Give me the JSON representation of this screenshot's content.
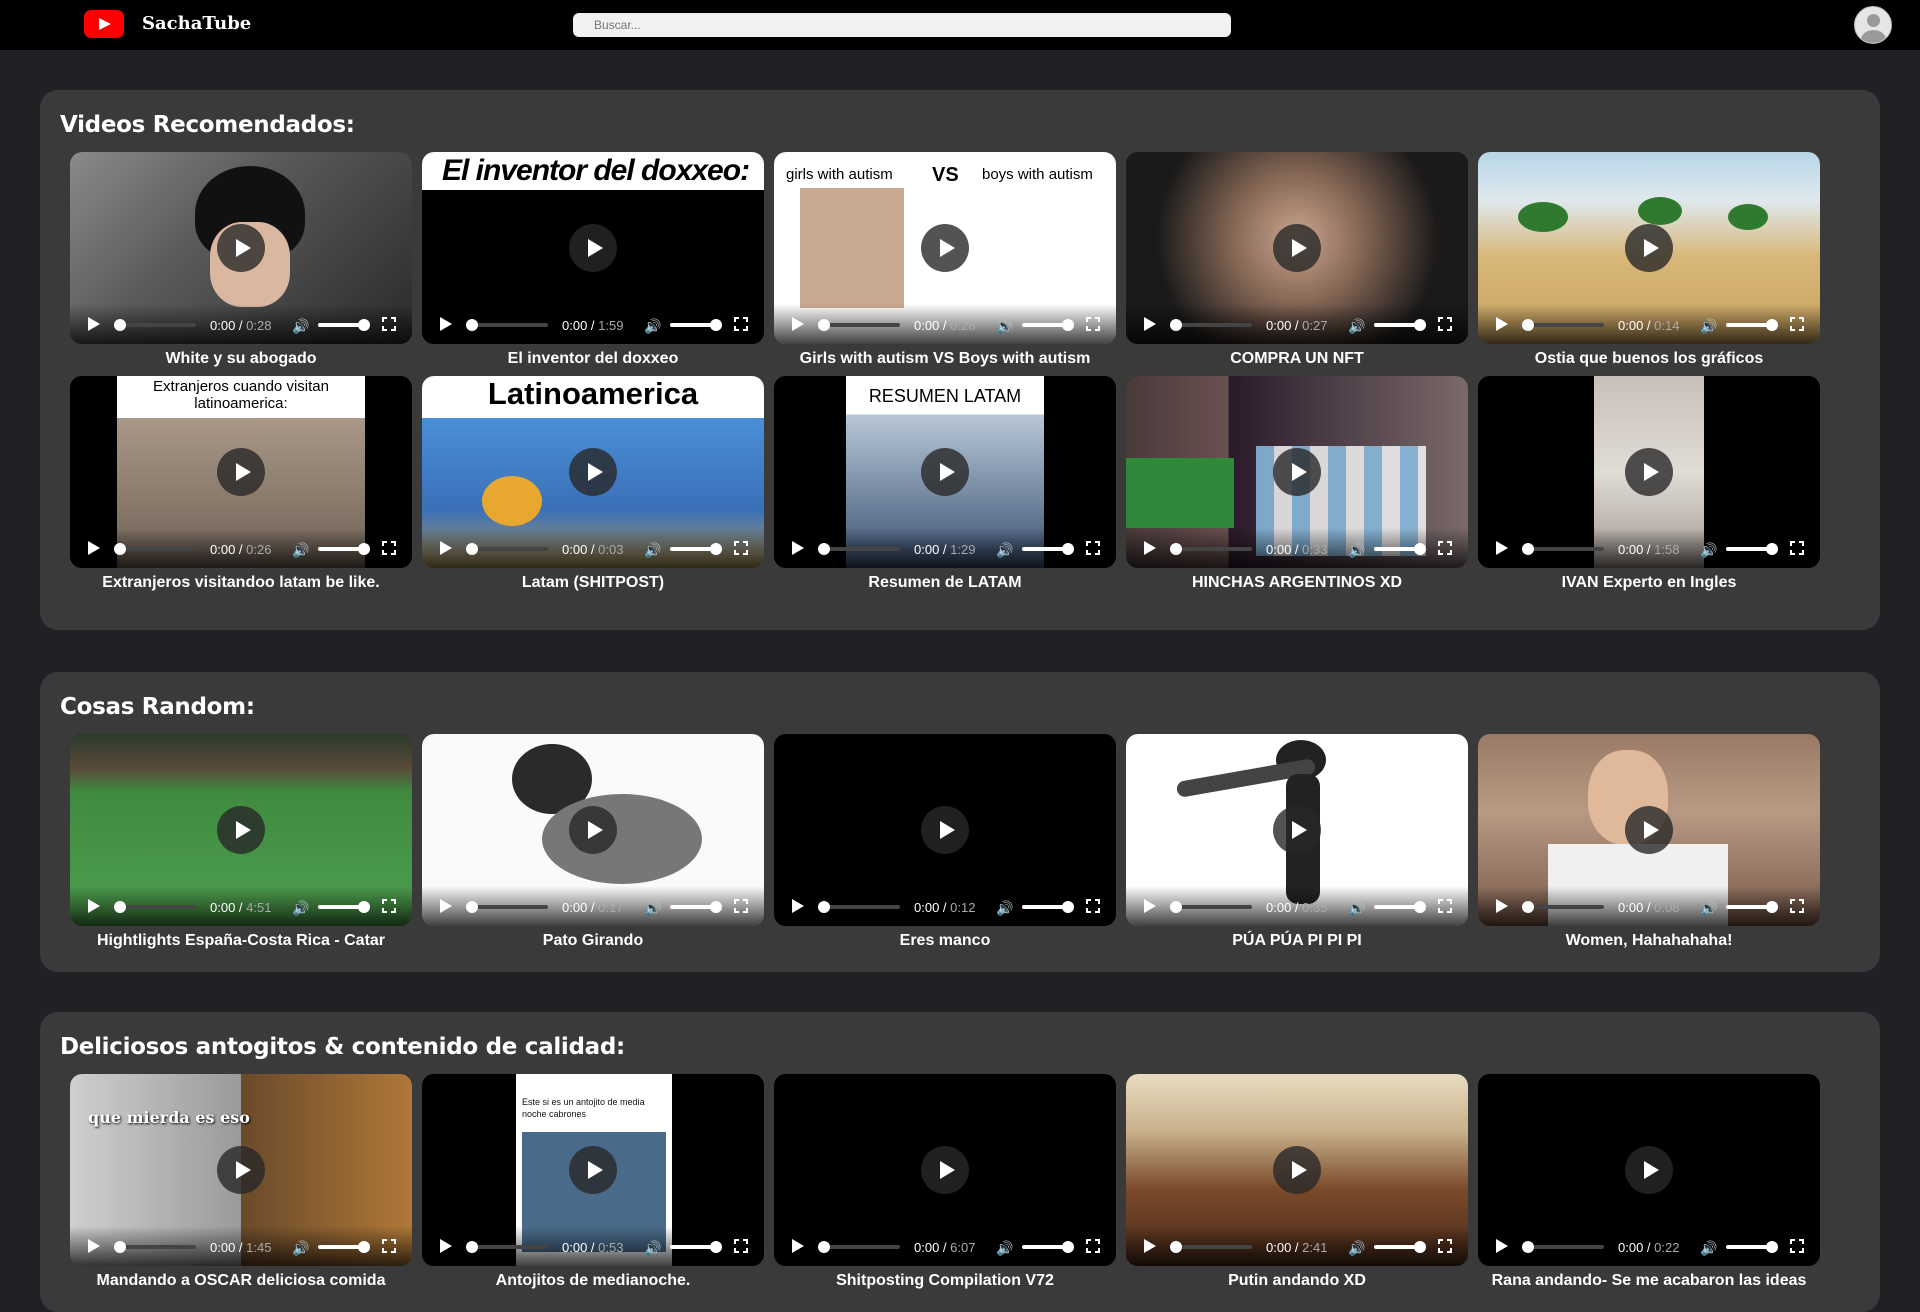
{
  "header": {
    "brand": "SachaTube",
    "search_placeholder": "Buscar..."
  },
  "sections": [
    {
      "title": "Videos Recomendados:",
      "videos": [
        {
          "title": "White y su abogado",
          "current": "0:00",
          "duration": "0:28"
        },
        {
          "title": "El inventor del doxxeo",
          "current": "0:00",
          "duration": "1:59",
          "overlay": "El inventor del doxxeo:"
        },
        {
          "title": "Girls with autism VS Boys with autism",
          "current": "0:00",
          "duration": "0:28",
          "overlay_left": "girls with autism",
          "overlay_mid": "VS",
          "overlay_right": "boys with autism"
        },
        {
          "title": "COMPRA UN NFT",
          "current": "0:00",
          "duration": "0:27"
        },
        {
          "title": "Ostia que buenos los gráficos",
          "current": "0:00",
          "duration": "0:14"
        },
        {
          "title": "Extranjeros visitandoo latam be like.",
          "current": "0:00",
          "duration": "0:26",
          "overlay": "Extranjeros cuando visitan latinoamerica:"
        },
        {
          "title": "Latam (SHITPOST)",
          "current": "0:00",
          "duration": "0:03",
          "overlay": "Latinoamerica"
        },
        {
          "title": "Resumen de LATAM",
          "current": "0:00",
          "duration": "1:29",
          "overlay": "RESUMEN LATAM"
        },
        {
          "title": "HINCHAS ARGENTINOS XD",
          "current": "0:00",
          "duration": "0:33"
        },
        {
          "title": "IVAN Experto en Ingles",
          "current": "0:00",
          "duration": "1:58"
        }
      ]
    },
    {
      "title": "Cosas Random:",
      "videos": [
        {
          "title": "Hightlights España-Costa Rica - Catar",
          "current": "0:00",
          "duration": "4:51"
        },
        {
          "title": "Pato Girando",
          "current": "0:00",
          "duration": "0:17"
        },
        {
          "title": "Eres manco",
          "current": "0:00",
          "duration": "0:12"
        },
        {
          "title": "PÚA PÚA PI PI PI",
          "current": "0:00",
          "duration": "0:35"
        },
        {
          "title": "Women, Hahahahaha!",
          "current": "0:00",
          "duration": "0:08"
        }
      ]
    },
    {
      "title": "Deliciosos antogitos & contenido de calidad:",
      "videos": [
        {
          "title": "Mandando a OSCAR deliciosa comida",
          "current": "0:00",
          "duration": "1:45",
          "overlay": "que mierda es eso"
        },
        {
          "title": "Antojitos de medianoche.",
          "current": "0:00",
          "duration": "0:53",
          "overlay": "Este si es un antojito de media noche cabrones"
        },
        {
          "title": "Shitposting Compilation V72",
          "current": "0:00",
          "duration": "6:07"
        },
        {
          "title": "Putin andando XD",
          "current": "0:00",
          "duration": "2:41"
        },
        {
          "title": "Rana andando- Se me acabaron las ideas",
          "current": "0:00",
          "duration": "0:22"
        }
      ]
    }
  ],
  "icons": {
    "logo": "youtube-logo-icon",
    "play": "play-icon",
    "volume": "volume-icon",
    "fullscreen": "fullscreen-icon",
    "avatar": "user-avatar-icon"
  },
  "colors": {
    "topbar": "#000000",
    "background": "#202124",
    "section": "#3a3a3a",
    "logo": "#ff0000"
  }
}
